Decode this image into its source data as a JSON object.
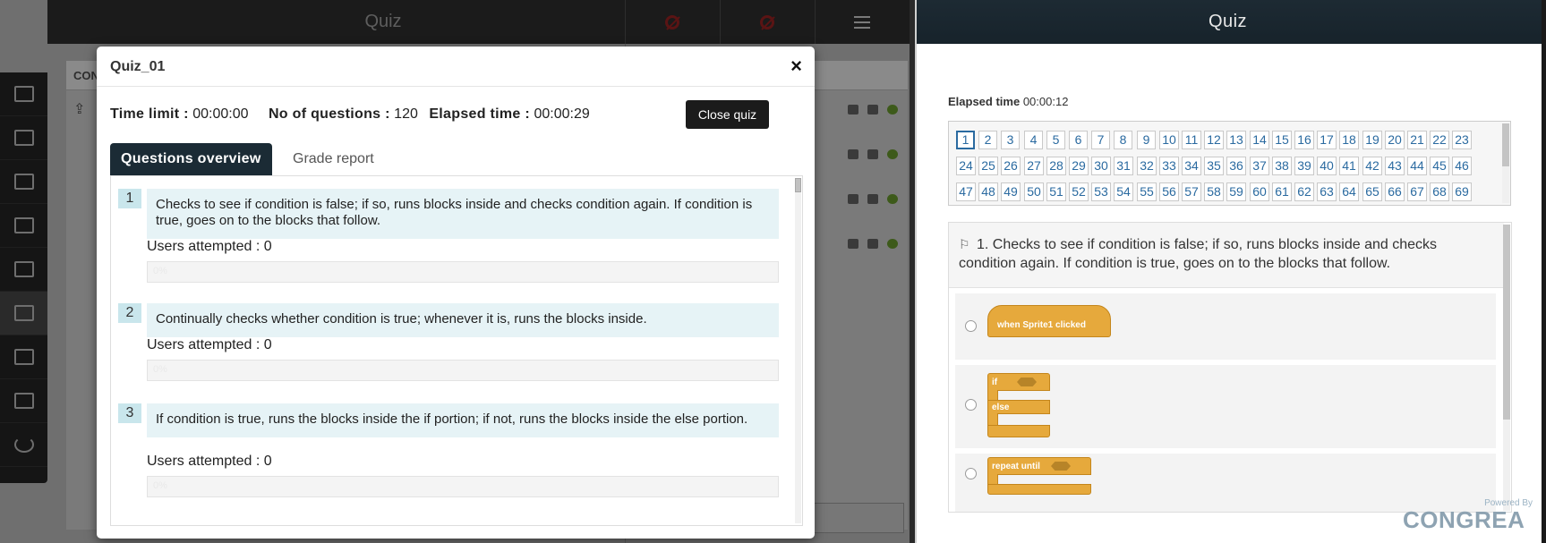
{
  "left": {
    "topbar_title": "Quiz",
    "bg_header": "CON",
    "bg_upload_icon": "upload-icon",
    "sidebar_icons": [
      "monitor-icon",
      "document-edit-icon",
      "line-chart-icon",
      "play-icon",
      "bar-chart-icon",
      "checkbox-icon",
      "notes-icon",
      "share-screen-icon",
      "power-icon"
    ]
  },
  "modal": {
    "title": "Quiz_01",
    "close_glyph": "×",
    "time_limit_label": "Time limit :",
    "time_limit_value": "00:00:00",
    "num_questions_label": "No of questions :",
    "num_questions_value": "120",
    "elapsed_label": "Elapsed time :",
    "elapsed_value": "00:00:29",
    "close_quiz_label": "Close quiz",
    "tabs": [
      "Questions overview",
      "Grade report"
    ],
    "questions": [
      {
        "num": "1",
        "text": "Checks to see if condition is false; if so, runs blocks inside and checks condition again. If condition is true, goes on to the blocks that follow.",
        "attempted": "Users attempted : 0",
        "progress_label": "0%"
      },
      {
        "num": "2",
        "text": "Continually checks whether condition is true; whenever it is, runs the blocks inside.",
        "attempted": "Users attempted : 0",
        "progress_label": "0%"
      },
      {
        "num": "3",
        "text": "If condition is true, runs the blocks inside the if portion; if not, runs the blocks inside the else portion.",
        "attempted": "Users attempted : 0",
        "progress_label": "0%"
      }
    ]
  },
  "right": {
    "title": "Quiz",
    "elapsed_label": "Elapsed time",
    "elapsed_value": "00:00:12",
    "question_numbers": [
      [
        "1",
        "2",
        "3",
        "4",
        "5",
        "6",
        "7",
        "8",
        "9",
        "10",
        "11",
        "12",
        "13",
        "14",
        "15",
        "16",
        "17",
        "18",
        "19",
        "20",
        "21",
        "22",
        "23"
      ],
      [
        "24",
        "25",
        "26",
        "27",
        "28",
        "29",
        "30",
        "31",
        "32",
        "33",
        "34",
        "35",
        "36",
        "37",
        "38",
        "39",
        "40",
        "41",
        "42",
        "43",
        "44",
        "45",
        "46"
      ],
      [
        "47",
        "48",
        "49",
        "50",
        "51",
        "52",
        "53",
        "54",
        "55",
        "56",
        "57",
        "58",
        "59",
        "60",
        "61",
        "62",
        "63",
        "64",
        "65",
        "66",
        "67",
        "68",
        "69"
      ]
    ],
    "active_question": "1",
    "question_prefix": "1.",
    "question_text": "Checks to see if condition is false; if so, runs blocks inside and checks condition again. If condition is true, goes on to the blocks that follow.",
    "flag_icon": "flag-icon",
    "options": [
      {
        "block_label": "when Sprite1 clicked"
      },
      {
        "block_label_if": "if",
        "block_label_else": "else"
      },
      {
        "block_label": "repeat until"
      }
    ],
    "powered_by": "Powered By",
    "brand": "CONGREA"
  }
}
